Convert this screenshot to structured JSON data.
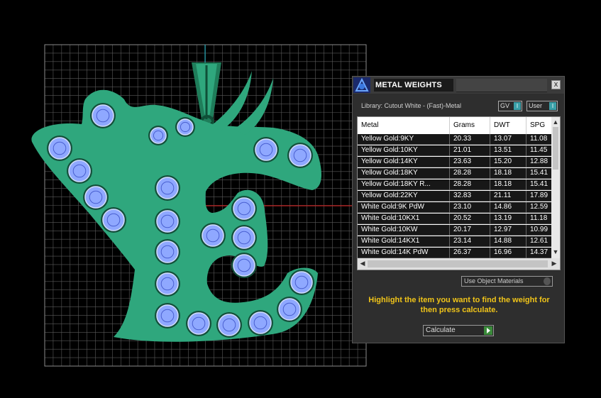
{
  "panel": {
    "title": "METAL WEIGHTS",
    "close_label": "x",
    "library_label": "Library: Cutout White - (Fast)-Metal",
    "gv_toggle": "GV",
    "user_toggle": "User",
    "toggle_knob": "I",
    "use_object_materials": "Use Object Materials",
    "hint": "Highlight the item you want to find the weight for then press calculate.",
    "calculate_label": "Calculate"
  },
  "table": {
    "columns": [
      "Metal",
      "Grams",
      "DWT",
      "SPG"
    ],
    "rows": [
      [
        "Yellow Gold:9KY",
        "20.33",
        "13.07",
        "11.08"
      ],
      [
        "Yellow Gold:10KY",
        "21.01",
        "13.51",
        "11.45"
      ],
      [
        "Yellow Gold:14KY",
        "23.63",
        "15.20",
        "12.88"
      ],
      [
        "Yellow Gold:18KY",
        "28.28",
        "18.18",
        "15.41"
      ],
      [
        "Yellow Gold:18KY R...",
        "28.28",
        "18.18",
        "15.41"
      ],
      [
        "Yellow Gold:22KY",
        "32.83",
        "21.11",
        "17.89"
      ],
      [
        "White Gold:9K PdW",
        "23.10",
        "14.86",
        "12.59"
      ],
      [
        "White Gold:10KX1",
        "20.52",
        "13.19",
        "11.18"
      ],
      [
        "White Gold:10KW",
        "20.17",
        "12.97",
        "10.99"
      ],
      [
        "White Gold:14KX1",
        "23.14",
        "14.88",
        "12.61"
      ],
      [
        "White Gold:14K PdW",
        "26.37",
        "16.96",
        "14.37"
      ]
    ]
  },
  "colors": {
    "metal": "#2fa77d",
    "metal_dark": "#1f7d5a",
    "gem": "#8fa8ff",
    "hint": "#f0c419",
    "grid": "#5a5a5a"
  }
}
